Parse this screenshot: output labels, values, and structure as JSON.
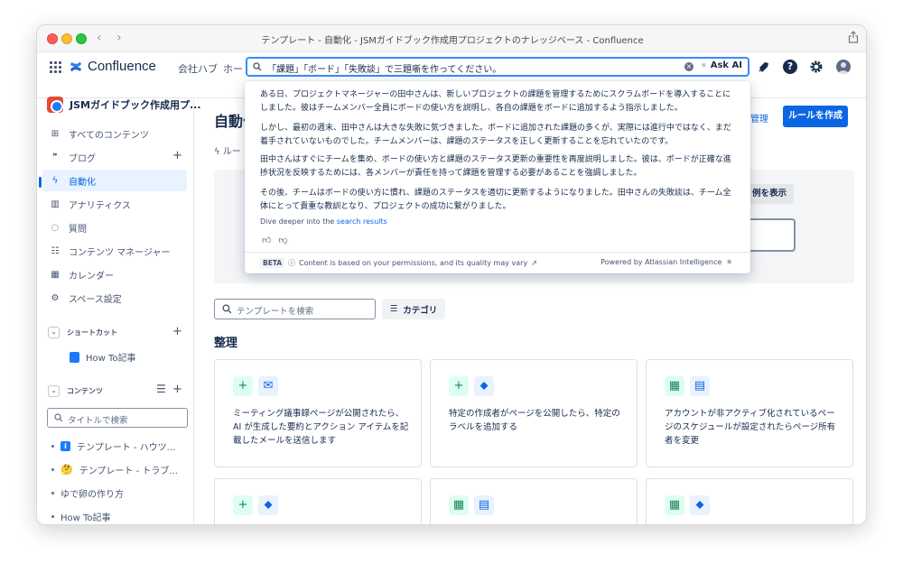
{
  "window": {
    "title": "テンプレート - 自動化 - JSMガイドブック作成用プロジェクトのナレッジベース - Confluence",
    "back": "‹",
    "forward": "›"
  },
  "topnav": {
    "logo": "Confluence",
    "links": [
      "会社ハブ",
      "ホー"
    ],
    "search_query": "「課題」「ボード」「失敗談」で三題噺を作ってください。",
    "ask_ai": "Ask AI"
  },
  "sidebar": {
    "space_name": "JSMガイドブック作成用プ...",
    "items": [
      {
        "icon": "⊞",
        "label": "すべてのコンテンツ"
      },
      {
        "icon": "❞",
        "label": "ブログ"
      },
      {
        "icon": "ϟ",
        "label": "自動化"
      },
      {
        "icon": "▥",
        "label": "アナリティクス"
      },
      {
        "icon": "◌",
        "label": "質問"
      },
      {
        "icon": "☷",
        "label": "コンテンツ マネージャー"
      },
      {
        "icon": "▦",
        "label": "カレンダー"
      },
      {
        "icon": "⚙",
        "label": "スペース設定"
      }
    ],
    "shortcuts_label": "ショートカット",
    "shortcut_item": "How To記事",
    "content_label": "コンテンツ",
    "search_placeholder": "タイトルで検索",
    "tree": [
      "テンプレート - ハウツ...",
      "テンプレート - トラブ...",
      "ゆで卵の作り方",
      "How To記事"
    ]
  },
  "main": {
    "title": "自動化",
    "tab": "ルー",
    "manage_link": "管理",
    "create_rule": "ルールを作成",
    "show_examples": "例を表示",
    "template_search_placeholder": "テンプレートを検索",
    "category_button": "カテゴリ",
    "section_title": "整理",
    "cards": [
      {
        "icons": [
          "plus",
          "mail"
        ],
        "desc": "ミーティング議事録ページが公開されたら、AI が生成した要約とアクション アイテムを記載したメールを送信します"
      },
      {
        "icons": [
          "plus",
          "tag"
        ],
        "desc": "特定の作成者がページを公開したら、特定のラベルを追加する"
      },
      {
        "icons": [
          "calendar",
          "doc"
        ],
        "desc": "アカウントが非アクティブ化されているページのスケジュールが設定されたらページ所有者を変更"
      },
      {
        "icons": [
          "plus",
          "tag"
        ],
        "desc": ""
      },
      {
        "icons": [
          "calendar",
          "doc"
        ],
        "desc": ""
      },
      {
        "icons": [
          "calendar",
          "tag"
        ],
        "desc": ""
      }
    ]
  },
  "ai_popup": {
    "paragraphs": [
      "ある日、プロジェクトマネージャーの田中さんは、新しいプロジェクトの課題を管理するためにスクラムボードを導入することにしました。彼はチームメンバー全員にボードの使い方を説明し、各自の課題をボードに追加するよう指示しました。",
      "しかし、最初の週末、田中さんは大きな失敗に気づきました。ボードに追加された課題の多くが、実際には進行中ではなく、まだ着手されていないものでした。チームメンバーは、課題のステータスを正しく更新することを忘れていたのです。",
      "田中さんはすぐにチームを集め、ボードの使い方と課題のステータス更新の重要性を再度説明しました。彼は、ボードが正確な進捗状況を反映するためには、各メンバーが責任を持って課題を管理する必要があることを強調しました。",
      "その後、チームはボードの使い方に慣れ、課題のステータスを適切に更新するようになりました。田中さんの失敗談は、チーム全体にとって貴重な教訓となり、プロジェクトの成功に繋がりました。"
    ],
    "dive_prefix": "Dive deeper into the ",
    "dive_link": "search results",
    "beta": "BETA",
    "disclaimer": "Content is based on your permissions, and its quality may vary",
    "powered": "Powered by Atlassian Intelligence"
  },
  "colors": {
    "accent": "#0c66e4",
    "search_border": "#388bff",
    "active_bg": "#e9f2ff"
  }
}
